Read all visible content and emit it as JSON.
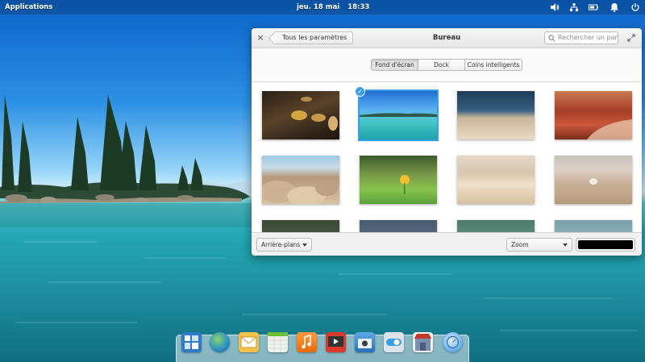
{
  "panel": {
    "applications_label": "Applications",
    "date": "jeu. 18 mai",
    "time": "18:33",
    "indicators": [
      "volume-icon",
      "network-icon",
      "battery-icon",
      "notifications-icon",
      "power-icon"
    ]
  },
  "window": {
    "title": "Bureau",
    "back_label": "Tous les paramètres",
    "search_placeholder": "Rechercher un para...",
    "tabs": [
      {
        "label": "Fond d'écran",
        "active": true
      },
      {
        "label": "Dock",
        "active": false
      },
      {
        "label": "Coins intelligents",
        "active": false
      }
    ],
    "wallpapers": [
      {
        "name": "autumn-leaves-wood",
        "selected": false
      },
      {
        "name": "tropical-lagoon",
        "selected": true
      },
      {
        "name": "ocean-sand",
        "selected": false
      },
      {
        "name": "red-rock-canyon",
        "selected": false
      },
      {
        "name": "beach-rocks",
        "selected": false
      },
      {
        "name": "yellow-flower-grass",
        "selected": false
      },
      {
        "name": "desert-dunes",
        "selected": false
      },
      {
        "name": "beach-shell",
        "selected": false
      }
    ],
    "footer": {
      "background_combo": "Arrière-plans",
      "fit_combo": "Zoom",
      "color": "#000000"
    }
  },
  "dock": {
    "apps": [
      "multitasking-view-icon",
      "web-browser-icon",
      "mail-icon",
      "calendar-icon",
      "music-icon",
      "videos-icon",
      "photos-icon",
      "settings-switchboard-icon",
      "appcenter-icon",
      "updates-icon"
    ]
  },
  "colors": {
    "accent": "#3d9ee8",
    "panel_text": "#ffffff"
  }
}
